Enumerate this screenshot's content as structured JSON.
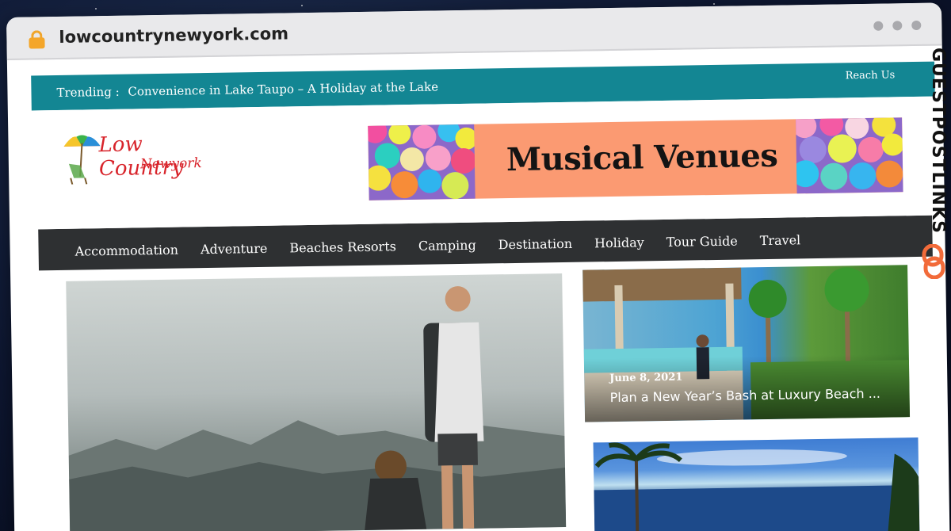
{
  "browser": {
    "url": "lowcountrynewyork.com"
  },
  "topbar": {
    "trending_label": "Trending :",
    "trending_text": "Convenience in Lake Taupo – A Holiday at the Lake",
    "reach_us": "Reach Us"
  },
  "logo": {
    "line1": "Low Country",
    "line2": "Newyork"
  },
  "banner": {
    "title": "Musical Venues"
  },
  "nav": {
    "items": [
      {
        "label": "Accommodation"
      },
      {
        "label": "Adventure"
      },
      {
        "label": "Beaches Resorts"
      },
      {
        "label": "Camping"
      },
      {
        "label": "Destination"
      },
      {
        "label": "Holiday"
      },
      {
        "label": "Tour Guide"
      },
      {
        "label": "Travel"
      }
    ]
  },
  "cards": [
    {
      "date": "June 8, 2021",
      "headline": "Plan a New Year’s Bash at Luxury Beach ..."
    }
  ],
  "watermark": {
    "text": "GUESTPOSTLINKS"
  },
  "colors": {
    "topbar": "#138693",
    "nav": "#2e3032",
    "logo_red": "#d8242b",
    "banner_bg": "#fb9a72",
    "watermark_icon": "#f26b3a"
  }
}
